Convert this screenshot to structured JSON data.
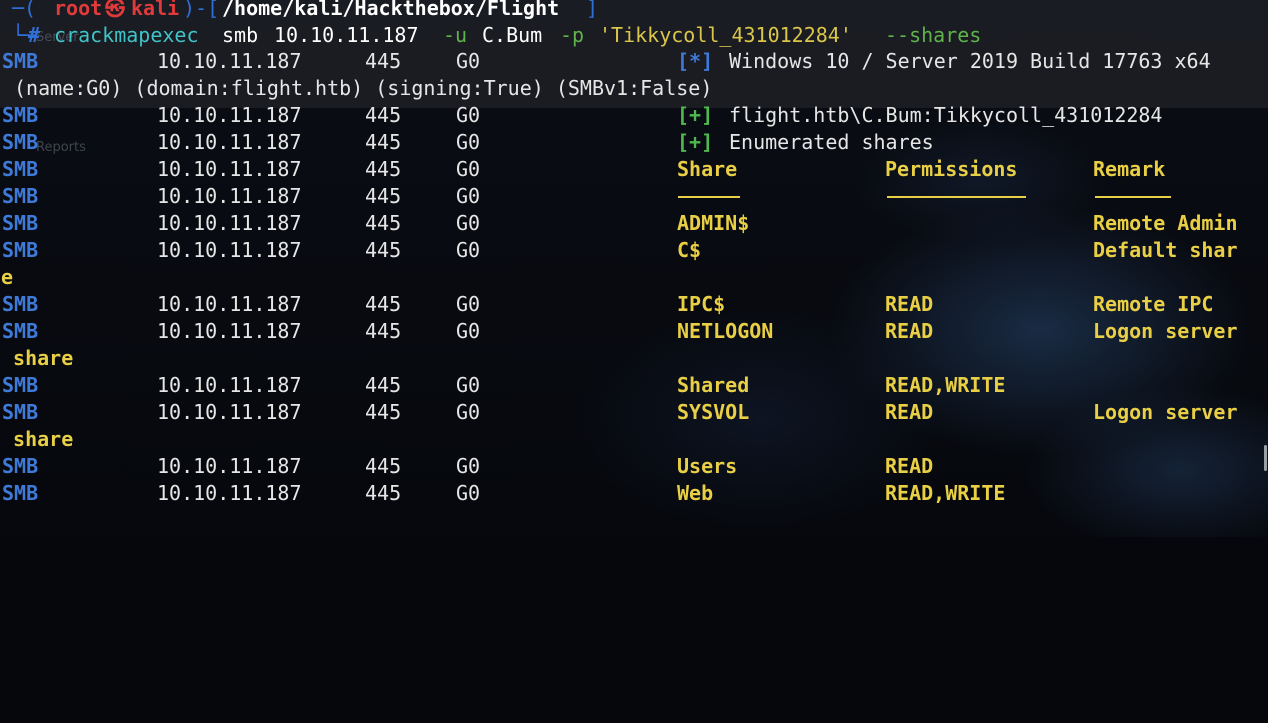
{
  "prompt": {
    "user": "root",
    "host": "kali",
    "skull": "㉿",
    "path": "/home/kali/Hackthebox/Flight",
    "symbol": "#"
  },
  "command": {
    "bin": "crackmapexec",
    "proto": "smb",
    "target": "10.10.11.187",
    "user_flag": "-u",
    "user": "C.Bum",
    "pass_flag": "-p",
    "password": "'Tikkycoll_431012284'",
    "opt": "--shares"
  },
  "ghost_labels": [
    "Server",
    "Reports"
  ],
  "lines": {
    "l1": {
      "proto": "SMB",
      "ip": "10.10.11.187",
      "port": "445",
      "host": "G0",
      "mark": "[*]",
      "text": "Windows 10 / Server 2019 Build 17763 x64"
    },
    "l2": {
      "text": "(name:G0) (domain:flight.htb) (signing:True) (SMBv1:False)"
    },
    "l3": {
      "proto": "SMB",
      "ip": "10.10.11.187",
      "port": "445",
      "host": "G0",
      "mark": "[+]",
      "text": "flight.htb\\C.Bum:Tikkycoll_431012284"
    },
    "l4": {
      "proto": "SMB",
      "ip": "10.10.11.187",
      "port": "445",
      "host": "G0",
      "mark": "[+]",
      "text": "Enumerated shares"
    }
  },
  "share_table": {
    "headers": {
      "share": "Share",
      "perm": "Permissions",
      "remark": "Remark"
    },
    "header_row": {
      "proto": "SMB",
      "ip": "10.10.11.187",
      "port": "445",
      "host": "G0"
    },
    "sep_row": {
      "proto": "SMB",
      "ip": "10.10.11.187",
      "port": "445",
      "host": "G0"
    },
    "rows": [
      {
        "proto": "SMB",
        "ip": "10.10.11.187",
        "port": "445",
        "host": "G0",
        "share": "ADMIN$",
        "perm": "",
        "remark": "Remote Admin",
        "wrap": ""
      },
      {
        "proto": "SMB",
        "ip": "10.10.11.187",
        "port": "445",
        "host": "G0",
        "share": "C$",
        "perm": "",
        "remark": "Default shar",
        "wrap": "e"
      },
      {
        "proto": "SMB",
        "ip": "10.10.11.187",
        "port": "445",
        "host": "G0",
        "share": "IPC$",
        "perm": "READ",
        "remark": "Remote IPC",
        "wrap": ""
      },
      {
        "proto": "SMB",
        "ip": "10.10.11.187",
        "port": "445",
        "host": "G0",
        "share": "NETLOGON",
        "perm": "READ",
        "remark": "Logon server",
        "wrap": " share"
      },
      {
        "proto": "SMB",
        "ip": "10.10.11.187",
        "port": "445",
        "host": "G0",
        "share": "Shared",
        "perm": "READ,WRITE",
        "remark": "",
        "wrap": ""
      },
      {
        "proto": "SMB",
        "ip": "10.10.11.187",
        "port": "445",
        "host": "G0",
        "share": "SYSVOL",
        "perm": "READ",
        "remark": "Logon server",
        "wrap": " share"
      },
      {
        "proto": "SMB",
        "ip": "10.10.11.187",
        "port": "445",
        "host": "G0",
        "share": "Users",
        "perm": "READ",
        "remark": "",
        "wrap": ""
      },
      {
        "proto": "SMB",
        "ip": "10.10.11.187",
        "port": "445",
        "host": "G0",
        "share": "Web",
        "perm": "READ,WRITE",
        "remark": "",
        "wrap": ""
      }
    ]
  },
  "colors": {
    "background": "#05070c",
    "prompt_frame": "#2f6fd6",
    "prompt_user": "#e03a3a",
    "smb_label": "#3f7ad8",
    "status_plus": "#4fb84f",
    "share_text": "#e9cf45",
    "command": "#3fc3c7",
    "flag": "#5fb34a",
    "string": "#d9c64a"
  }
}
